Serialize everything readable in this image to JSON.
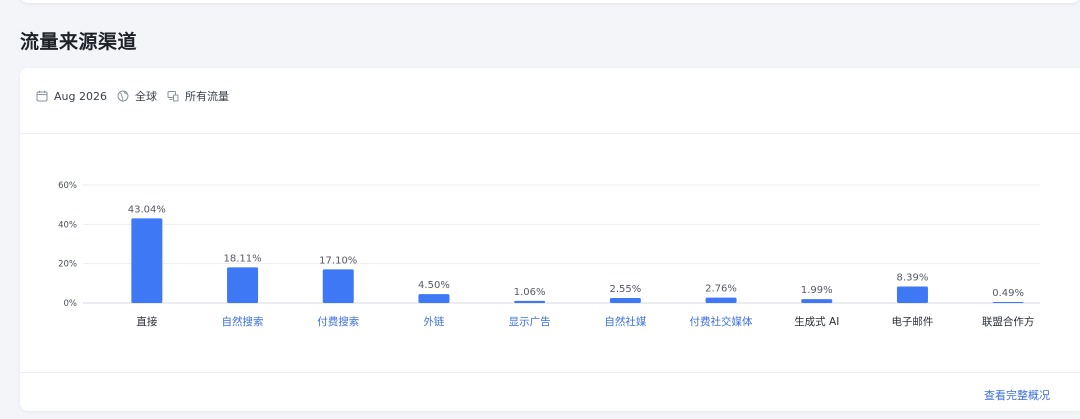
{
  "section": {
    "title": "流量来源渠道"
  },
  "filters": {
    "date": {
      "icon": "calendar-icon",
      "label": "Aug 2026"
    },
    "region": {
      "icon": "globe-icon",
      "label": "全球"
    },
    "traffic": {
      "icon": "devices-icon",
      "label": "所有流量"
    }
  },
  "colors": {
    "bar": "#3f78f5",
    "link": "#3b6fe0",
    "axis_text": "#4a4f57",
    "grid": "#eceef2"
  },
  "chart_data": {
    "type": "bar",
    "categories": [
      "直接",
      "自然搜索",
      "付费搜索",
      "外链",
      "显示广告",
      "自然社媒",
      "付费社交媒体",
      "生成式 AI",
      "电子邮件",
      "联盟合作方"
    ],
    "category_is_link": [
      false,
      true,
      true,
      true,
      true,
      true,
      true,
      false,
      false,
      false
    ],
    "values": [
      43.04,
      18.11,
      17.1,
      4.5,
      1.06,
      2.55,
      2.76,
      1.99,
      8.39,
      0.49
    ],
    "value_labels": [
      "43.04%",
      "18.11%",
      "17.10%",
      "4.50%",
      "1.06%",
      "2.55%",
      "2.76%",
      "1.99%",
      "8.39%",
      "0.49%"
    ],
    "y_ticks": [
      0,
      20,
      40,
      60
    ],
    "y_tick_labels": [
      "0%",
      "20%",
      "40%",
      "60%"
    ],
    "ylim": [
      0,
      60
    ],
    "grid": true
  },
  "footer": {
    "link_label": "查看完整概况"
  }
}
